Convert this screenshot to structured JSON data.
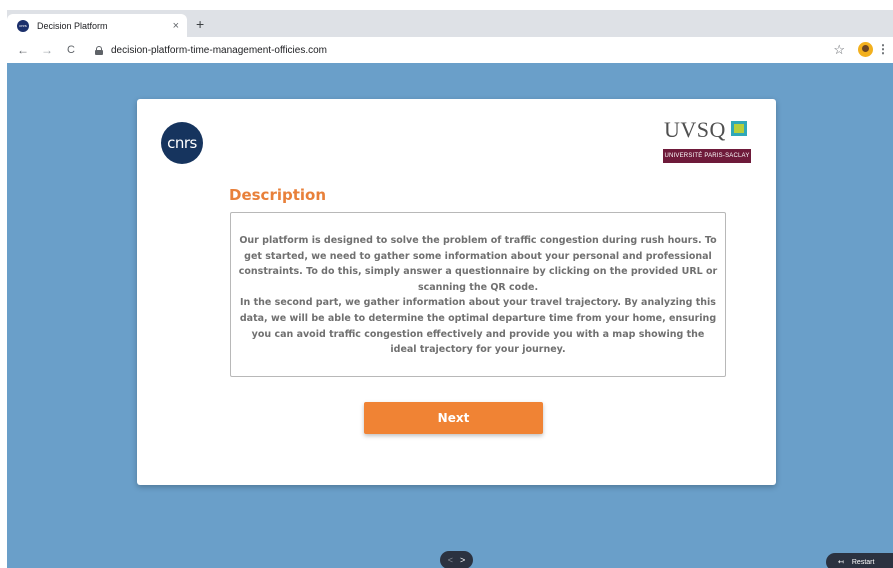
{
  "browser": {
    "tab_title": "Decision Platform",
    "tab_close": "×",
    "new_tab": "+",
    "back": "←",
    "forward": "→",
    "reload": "C",
    "url": "decision-platform-time-management-officies.com",
    "star": "☆",
    "menu": "⋮",
    "favicon_text": "cnrs"
  },
  "card": {
    "left_logo_text": "cnrs",
    "right_logo_text": "UVSQ",
    "right_logo_band": "UNIVERSITÉ PARIS-SACLAY",
    "title": "Description",
    "paragraph1": "Our platform is designed to solve the problem of traffic congestion during rush hours. To get started, we need to gather some information about your personal and professional constraints. To do this, simply answer a questionnaire by clicking on the provided URL or scanning the QR code.",
    "paragraph2": "In the second part, we gather information about your travel trajectory. By analyzing this data, we will be able to determine the optimal departure time from your home, ensuring you can avoid traffic congestion effectively and provide you with a map showing the ideal trajectory for your journey.",
    "next_label": "Next"
  },
  "controls": {
    "prev": "<",
    "next": ">",
    "restart_icon": "↤",
    "restart_label": "Restart"
  },
  "colors": {
    "page_bg": "#6a9fc9",
    "accent": "#f08334",
    "title_color": "#e8803a"
  }
}
